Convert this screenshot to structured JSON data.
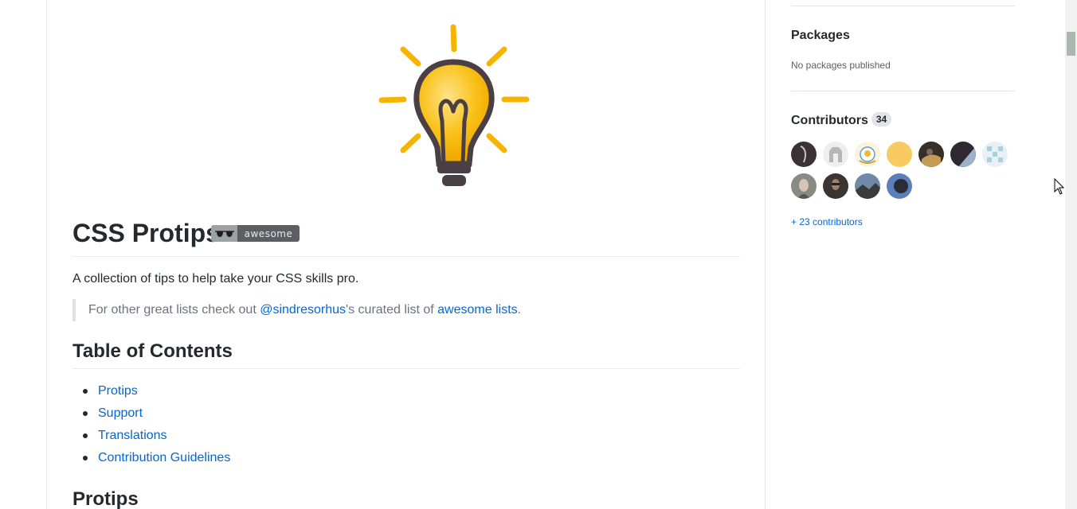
{
  "readme": {
    "title": "CSS Protips",
    "badge_label": "awesome",
    "description": "A collection of tips to help take your CSS skills pro.",
    "quote": {
      "prefix": "For other great lists check out ",
      "user_link": "@sindresorhus",
      "middle": "'s curated list of ",
      "lists_link": "awesome lists",
      "suffix": "."
    },
    "toc_heading": "Table of Contents",
    "toc_items": [
      "Protips",
      "Support",
      "Translations",
      "Contribution Guidelines"
    ],
    "next_heading": "Protips"
  },
  "sidebar": {
    "packages_heading": "Packages",
    "packages_text": "No packages published",
    "contributors_heading": "Contributors",
    "contributors_count": "34",
    "more_contributors": "+ 23 contributors"
  },
  "colors": {
    "link": "#0366d6",
    "bulb_yellow": "#f5b400",
    "bulb_outline": "#4a3f45"
  }
}
